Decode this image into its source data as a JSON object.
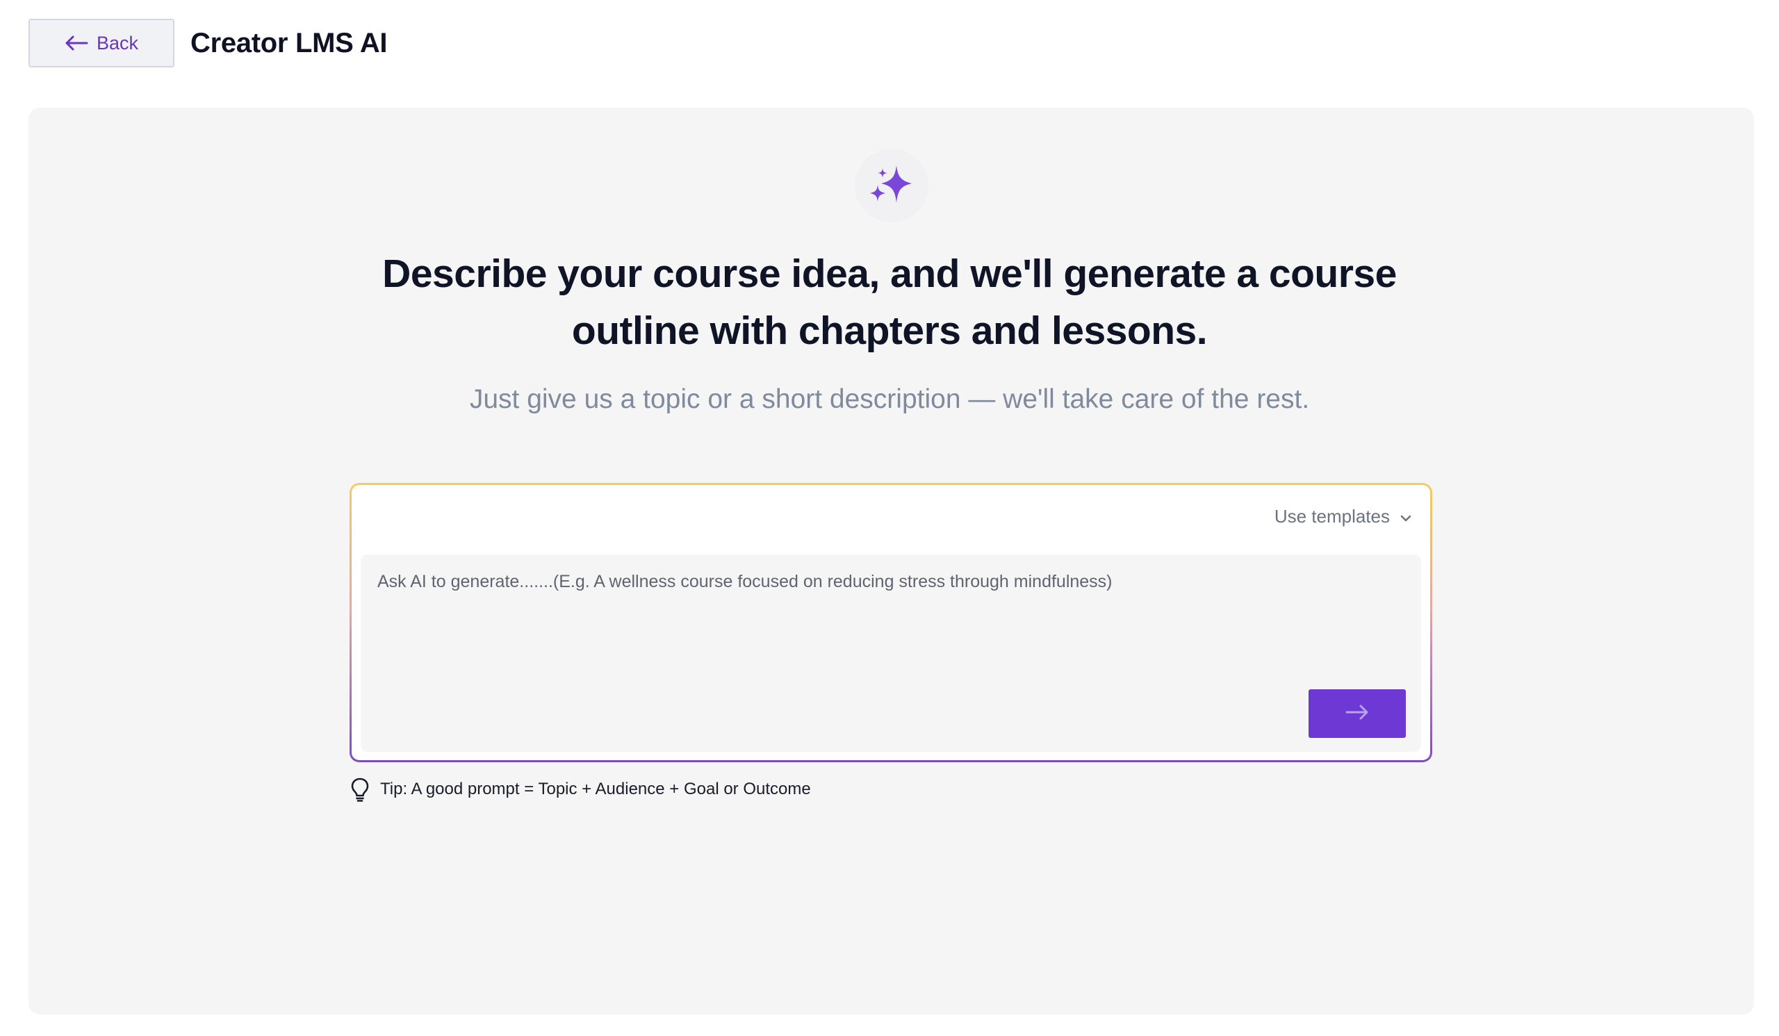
{
  "header": {
    "back_label": "Back",
    "title": "Creator LMS AI"
  },
  "hero": {
    "icon": "sparkles-icon",
    "headline_line1": "Describe your course idea, and we'll generate a course",
    "headline_line2": "outline with chapters and lessons.",
    "subline": "Just give us a topic or a short description — we'll take care of the rest."
  },
  "prompt": {
    "templates_label": "Use templates",
    "placeholder": "Ask AI to generate.......(E.g. A wellness course focused on reducing stress through mindfulness)",
    "value": "",
    "submit_icon": "arrow-right-icon"
  },
  "tip": {
    "icon": "lightbulb-icon",
    "text": "Tip: A good prompt = Topic + Audience + Goal or Outcome"
  },
  "colors": {
    "accent": "#6e38d4",
    "back_text": "#6b34c4",
    "panel_bg": "#f5f5f6",
    "border_top": "#f4cc5e",
    "border_bottom": "#7a4dc0"
  }
}
